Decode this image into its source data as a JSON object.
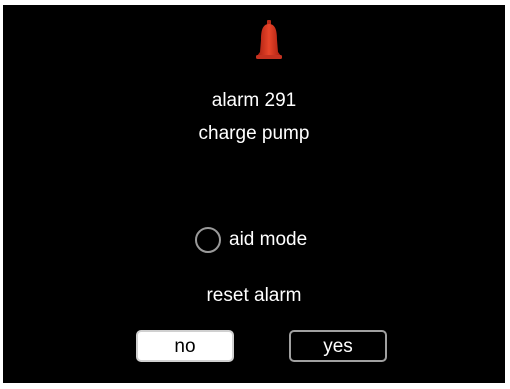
{
  "alarm": {
    "code": "alarm 291",
    "description": "charge pump",
    "icon": "bell-icon",
    "icon_color": "#d8341c"
  },
  "aid_mode": {
    "label": "aid mode",
    "checked": false
  },
  "reset": {
    "title": "reset alarm",
    "no_label": "no",
    "yes_label": "yes",
    "selected": "no"
  }
}
